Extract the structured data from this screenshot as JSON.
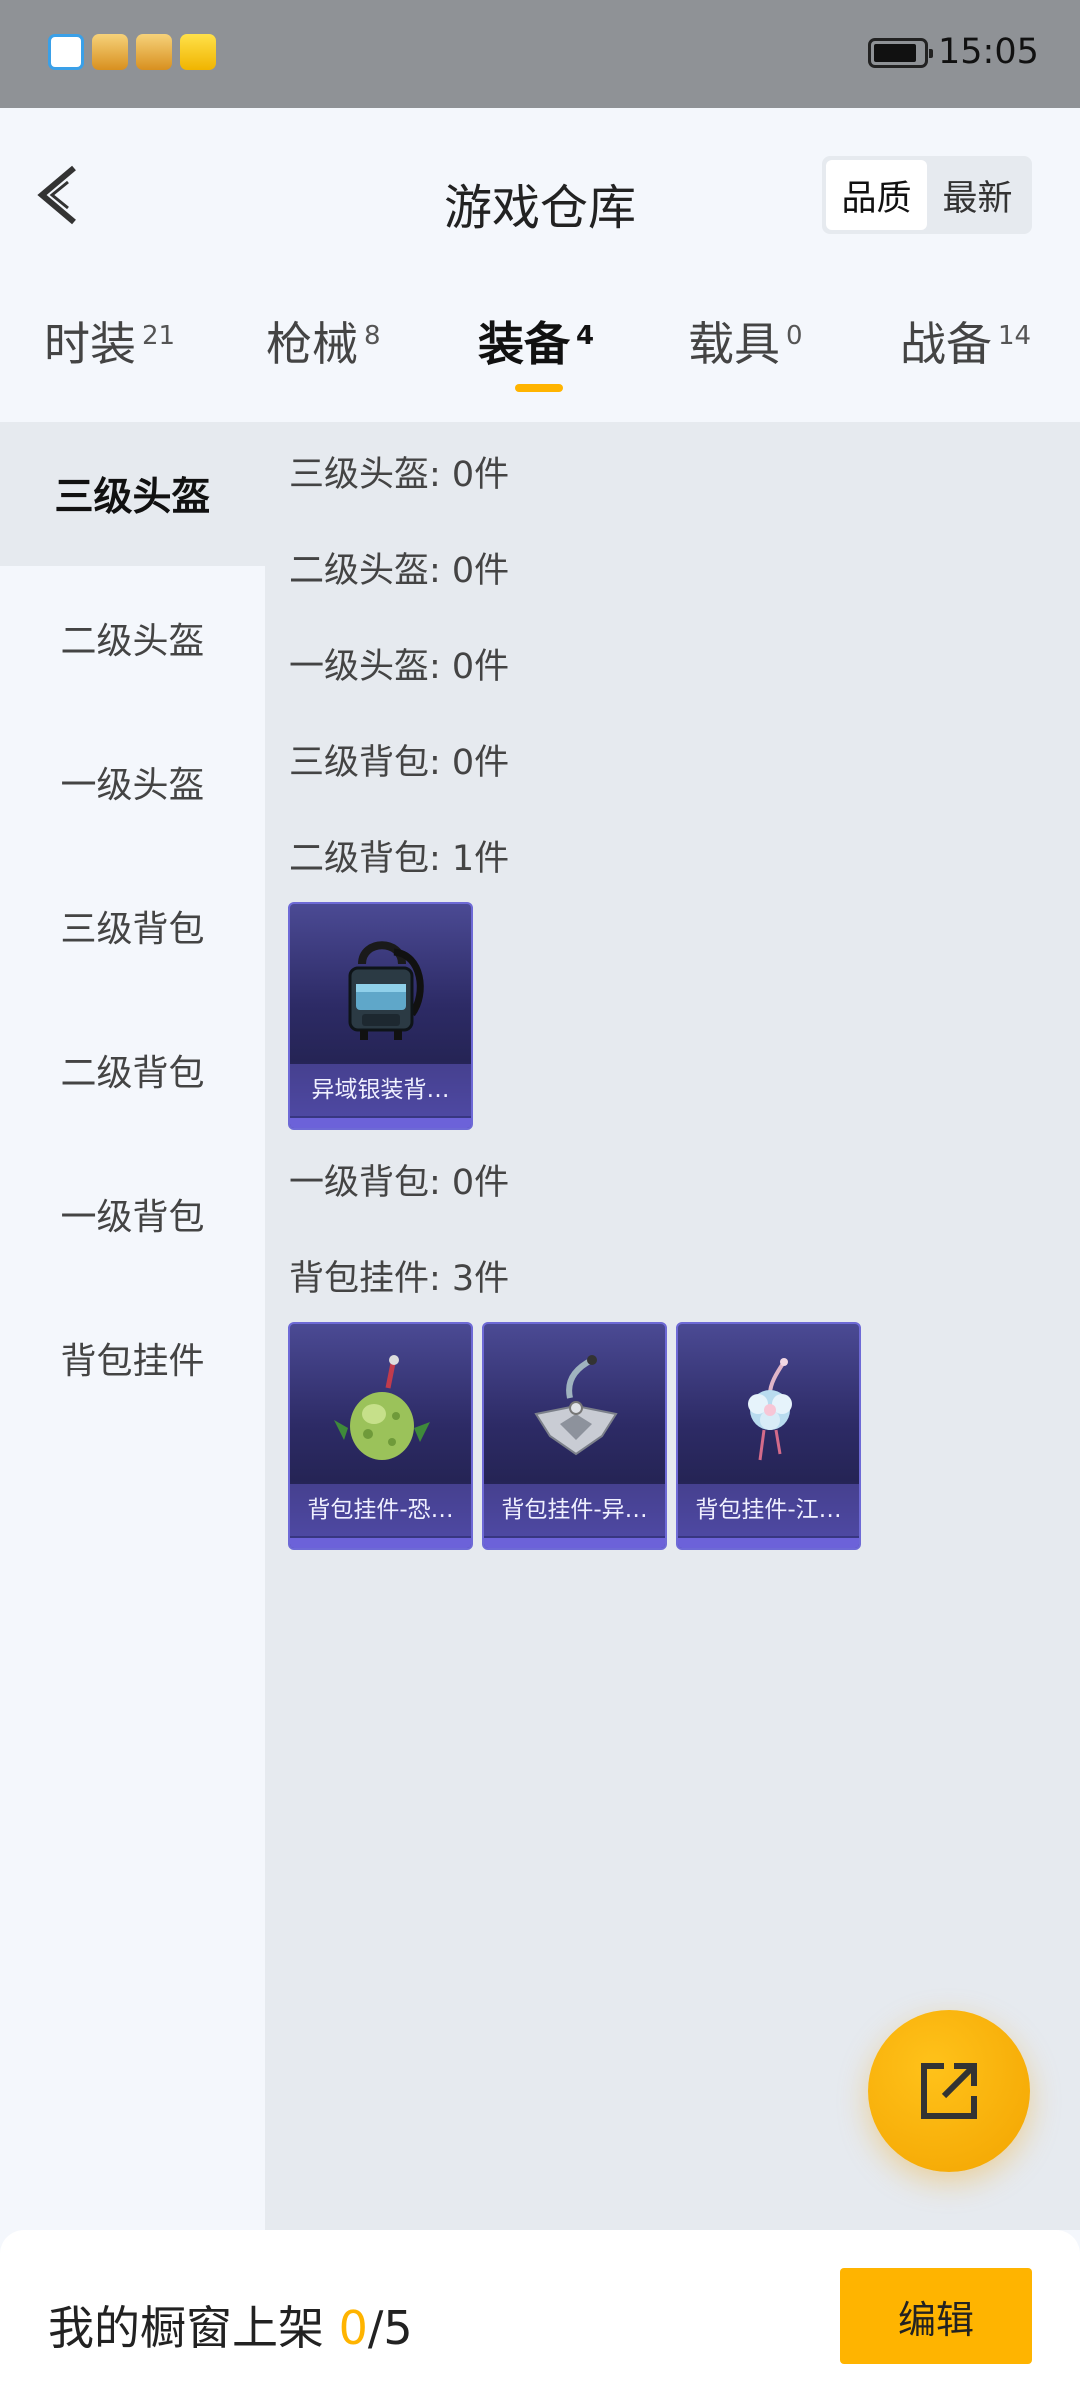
{
  "status_bar": {
    "time": "15:05",
    "notification_icons": [
      "qq-icon",
      "game-app-icon",
      "game-app-icon",
      "pokemon-app-icon"
    ]
  },
  "header": {
    "title": "游戏仓库",
    "sort_options": [
      {
        "label": "品质",
        "active": true
      },
      {
        "label": "最新",
        "active": false
      }
    ]
  },
  "tabs": [
    {
      "label": "时装",
      "count": "21"
    },
    {
      "label": "枪械",
      "count": "8"
    },
    {
      "label": "装备",
      "count": "4",
      "active": true
    },
    {
      "label": "载具",
      "count": "0"
    },
    {
      "label": "战备",
      "count": "14"
    }
  ],
  "sidebar": {
    "items": [
      "三级头盔",
      "二级头盔",
      "一级头盔",
      "三级背包",
      "二级背包",
      "一级背包",
      "背包挂件"
    ],
    "active_index": 0
  },
  "categories": [
    {
      "label": "三级头盔: 0件"
    },
    {
      "label": "二级头盔: 0件"
    },
    {
      "label": "一级头盔: 0件"
    },
    {
      "label": "三级背包: 0件"
    },
    {
      "label": "二级背包: 1件",
      "items": [
        {
          "name": "异域银装背…",
          "icon": "backpack-icon"
        }
      ]
    },
    {
      "label": "一级背包: 0件"
    },
    {
      "label": "背包挂件: 3件",
      "items": [
        {
          "name": "背包挂件-恐…",
          "icon": "dino-egg-charm-icon"
        },
        {
          "name": "背包挂件-异…",
          "icon": "silver-wing-charm-icon"
        },
        {
          "name": "背包挂件-江…",
          "icon": "flower-charm-icon"
        }
      ]
    }
  ],
  "bottom_bar": {
    "label": "我的橱窗上架",
    "count_current": "0",
    "count_total": "/5",
    "edit_label": "编辑"
  },
  "colors": {
    "accent": "#ffb400",
    "card_bg": "#2d2b66",
    "card_border": "#6e6ad6"
  }
}
